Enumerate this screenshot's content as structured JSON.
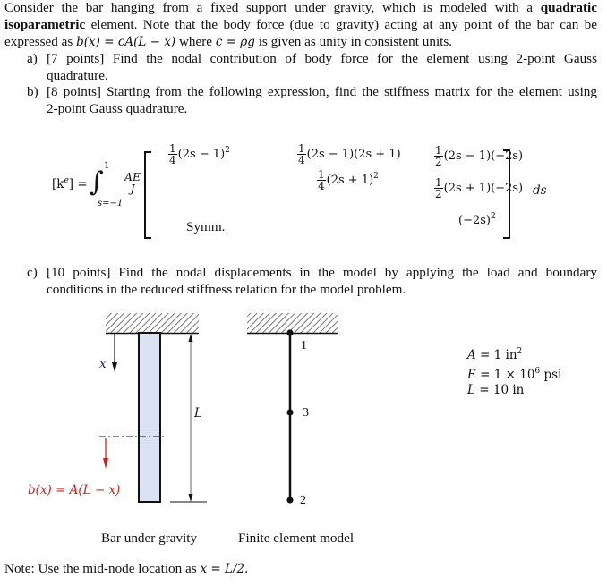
{
  "problem": {
    "intro_line1_pre": "Consider the bar hanging from a fixed support under gravity, which is modeled with a",
    "intro_bold1": "quadratic",
    "intro_bold2": "isoparametric",
    "intro_line2_post": "element. Note that the body force (due to gravity) acting at any point of the bar can be",
    "intro_line3_pre": "expressed as",
    "intro_line3_eq1": "b(x) = cA(L − x)",
    "intro_line3_mid": "where",
    "intro_line3_eq2": "c = ρg",
    "intro_line3_post": "is given as unity in consistent units.",
    "parts": [
      {
        "label": "a)",
        "line1": "[7 points] Find the nodal contribution of body force for the element using 2-point Gauss",
        "line2": "quadrature."
      },
      {
        "label": "b)",
        "line1": "[8 points] Starting from the following expression, find the stiffness matrix for the element using",
        "line2": "2-point Gauss quadrature."
      },
      {
        "label": "c)",
        "line1": "[10 points] Find the nodal displacements in the model by applying the load and boundary",
        "line2": "conditions in the reduced stiffness relation for the model problem."
      }
    ]
  },
  "equation": {
    "lhs": "[k",
    "lhs_sup": "e",
    "lhs_close": "] =",
    "integral": "∫",
    "upper_limit": "1",
    "lower_limit": "s=−1",
    "coef_num": "AE",
    "coef_den": "J",
    "differential": "ds",
    "matrix": {
      "r1c1": {
        "num": "1",
        "den": "4",
        "expr": "(2s − 1)",
        "sup": "2"
      },
      "r1c2": {
        "num": "1",
        "den": "4",
        "expr": "(2s − 1)(2s + 1)"
      },
      "r1c3": {
        "num": "1",
        "den": "2",
        "expr": "(2s − 1)(−2s)"
      },
      "r2c2": {
        "num": "1",
        "den": "4",
        "expr": "(2s + 1)",
        "sup": "2"
      },
      "r2c3": {
        "num": "1",
        "den": "2",
        "expr": "(2s + 1)(−2s)"
      },
      "r3c3": {
        "expr": "(−2s)",
        "sup": "2"
      },
      "symm": "Symm."
    }
  },
  "figure": {
    "left": {
      "x_label": "x",
      "L_label": "L",
      "body_force_label": "b(x) = A(L − x)",
      "caption": "Bar under gravity",
      "bar_color": "#d9e1f2",
      "force_color": "#d0201a"
    },
    "right": {
      "nodes": [
        "1",
        "3",
        "2"
      ],
      "caption": "Finite element model"
    },
    "properties": [
      {
        "lhs": "A",
        "rhs": "= 1 in",
        "sup": "2"
      },
      {
        "lhs": "E",
        "rhs": "= 1 × 10",
        "sup": "6",
        "tail": " psi"
      },
      {
        "lhs": "L",
        "rhs": "= 10 in"
      }
    ]
  },
  "note": {
    "text": "Note: Use the mid-node location as",
    "eq": "x = L/2."
  }
}
